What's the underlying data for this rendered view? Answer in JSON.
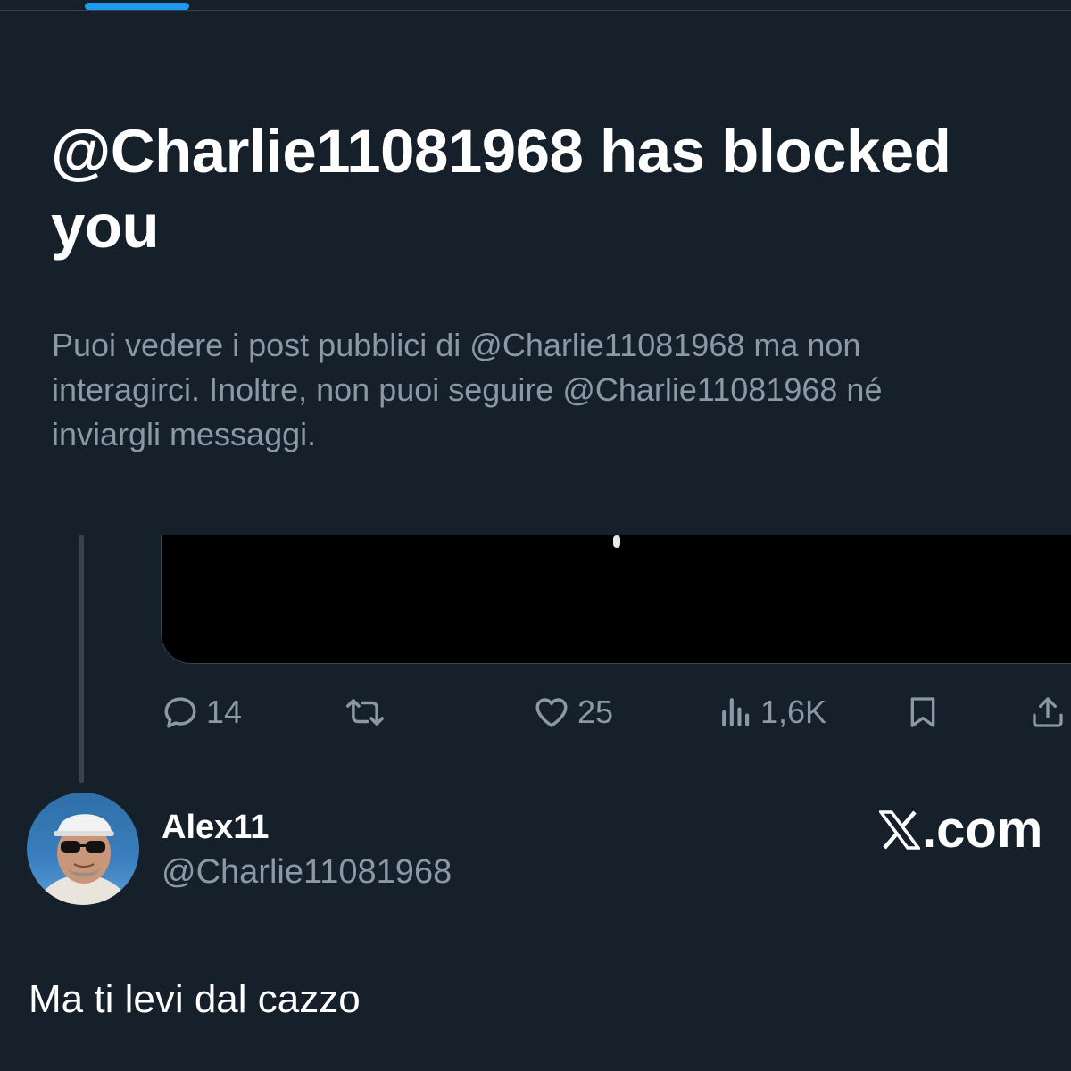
{
  "block_notice": {
    "title": "@Charlie11081968 has blocked you",
    "description": "Puoi vedere i post pubblici di @Charlie11081968 ma non interagirci. Inoltre, non puoi seguire @Charlie11081968 né inviargli messaggi."
  },
  "post_actions": {
    "reply_icon": "reply-icon",
    "reply_count": "14",
    "repost_icon": "repost-icon",
    "like_icon": "heart-icon",
    "like_count": "25",
    "views_icon": "views-icon",
    "views_count": "1,6K",
    "bookmark_icon": "bookmark-icon",
    "share_icon": "share-icon"
  },
  "reply": {
    "display_name": "Alex11",
    "handle": "@Charlie11081968",
    "text": "Ma ti levi dal cazzo"
  },
  "watermark": {
    "logo_icon": "x-logo-icon",
    "text": ".com"
  },
  "colors": {
    "background": "#15202b",
    "secondary_text": "#8b98a5",
    "accent": "#1d9bf0",
    "divider": "#38444d"
  }
}
